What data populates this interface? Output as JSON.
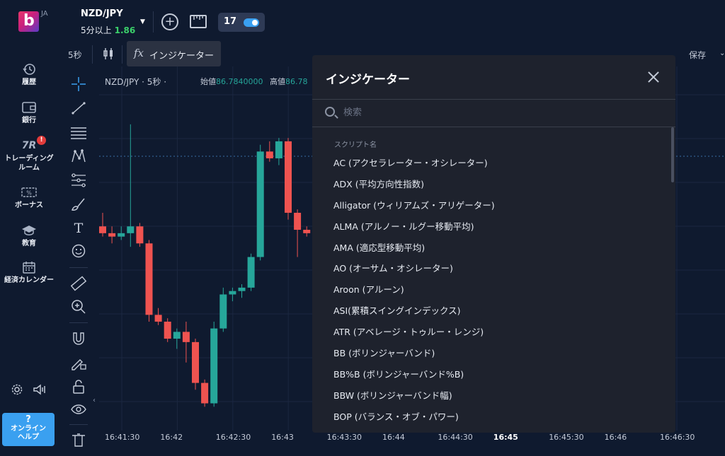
{
  "app": {
    "logo_letter": "b",
    "lang": "JA"
  },
  "sidebar": {
    "items": [
      {
        "label": "履歴",
        "icon": "history-icon"
      },
      {
        "label": "銀行",
        "icon": "wallet-icon"
      },
      {
        "label": "トレーディング\nルーム",
        "icon": "tr-icon",
        "badge": "!"
      },
      {
        "label": "ボーナス",
        "icon": "bonus-icon"
      },
      {
        "label": "教育",
        "icon": "graduation-cap-icon"
      },
      {
        "label": "経済カレンダー",
        "icon": "calendar-icon"
      }
    ],
    "help_q": "?",
    "help_label": "オンライン\nヘルプ"
  },
  "topbar": {
    "pair": "NZD/JPY",
    "expiry": "5分以上",
    "payout": "1.86"
  },
  "chart_toolbar": {
    "interval": "5秒",
    "indicator_label": "インジケーター",
    "save_label": "保存"
  },
  "chart": {
    "header": "NZD/JPY · 5秒 ·",
    "open_label": "始値",
    "open_value": "86.7840000",
    "high_label": "高値",
    "high_value": "86.78",
    "time_labels": [
      "16:41:30",
      "16:42",
      "16:42:30",
      "16:43",
      "16:43:30",
      "16:44",
      "16:44:30",
      "16:45",
      "16:45:30",
      "16:46",
      "16:46:30"
    ],
    "bold_time": "16:45",
    "up_color": "#26a69a",
    "down_color": "#ef5350",
    "candles": [
      {
        "o": 86.798,
        "h": 86.802,
        "l": 86.795,
        "c": 86.796
      },
      {
        "o": 86.796,
        "h": 86.798,
        "l": 86.793,
        "c": 86.795
      },
      {
        "o": 86.795,
        "h": 86.798,
        "l": 86.794,
        "c": 86.796
      },
      {
        "o": 86.796,
        "h": 86.828,
        "l": 86.792,
        "c": 86.798
      },
      {
        "o": 86.798,
        "h": 86.799,
        "l": 86.792,
        "c": 86.793
      },
      {
        "o": 86.793,
        "h": 86.794,
        "l": 86.77,
        "c": 86.772
      },
      {
        "o": 86.772,
        "h": 86.774,
        "l": 86.769,
        "c": 86.77
      },
      {
        "o": 86.77,
        "h": 86.771,
        "l": 86.764,
        "c": 86.765
      },
      {
        "o": 86.765,
        "h": 86.768,
        "l": 86.762,
        "c": 86.767
      },
      {
        "o": 86.767,
        "h": 86.77,
        "l": 86.758,
        "c": 86.764
      },
      {
        "o": 86.764,
        "h": 86.765,
        "l": 86.75,
        "c": 86.752
      },
      {
        "o": 86.752,
        "h": 86.753,
        "l": 86.745,
        "c": 86.746
      },
      {
        "o": 86.746,
        "h": 86.77,
        "l": 86.745,
        "c": 86.768
      },
      {
        "o": 86.768,
        "h": 86.78,
        "l": 86.767,
        "c": 86.778
      },
      {
        "o": 86.778,
        "h": 86.78,
        "l": 86.776,
        "c": 86.779
      },
      {
        "o": 86.779,
        "h": 86.781,
        "l": 86.777,
        "c": 86.78
      },
      {
        "o": 86.78,
        "h": 86.79,
        "l": 86.779,
        "c": 86.789
      },
      {
        "o": 86.789,
        "h": 86.822,
        "l": 86.788,
        "c": 86.82
      },
      {
        "o": 86.82,
        "h": 86.823,
        "l": 86.817,
        "c": 86.818
      },
      {
        "o": 86.818,
        "h": 86.824,
        "l": 86.816,
        "c": 86.823
      },
      {
        "o": 86.823,
        "h": 86.824,
        "l": 86.8,
        "c": 86.802
      },
      {
        "o": 86.802,
        "h": 86.803,
        "l": 86.789,
        "c": 86.797
      },
      {
        "o": 86.797,
        "h": 86.798,
        "l": 86.795,
        "c": 86.796
      }
    ]
  },
  "modal": {
    "title": "インジケーター",
    "search_placeholder": "検索",
    "list_header": "スクリプト名",
    "items": [
      "AC (アクセラレーター・オシレーター)",
      "ADX (平均方向性指数)",
      "Alligator (ウィリアムズ・アリゲーター)",
      "ALMA (アルノー・ルグー移動平均)",
      "AMA (適応型移動平均)",
      "AO (オーサム・オシレーター)",
      "Aroon (アルーン)",
      "ASI(累積スイングインデックス)",
      "ATR (アベレージ・トゥルー・レンジ)",
      "BB (ボリンジャーバンド)",
      "BB%B (ボリンジャーバンド%B)",
      "BBW (ボリンジャーバンド幅)",
      "BOP (バランス・オブ・パワー)"
    ]
  }
}
